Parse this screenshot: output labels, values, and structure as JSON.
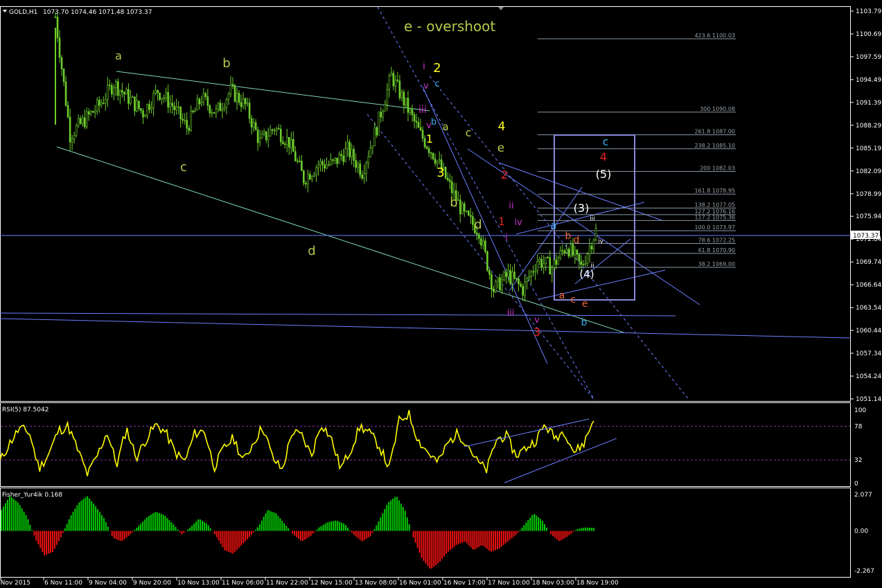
{
  "header": {
    "symbol": "GOLD,H1",
    "ohlc": "1073.70 1074.46 1071.48 1073.37",
    "current_price": "1073.37"
  },
  "colors": {
    "bull": "#6ecf2c",
    "bear": "#6ecf2c",
    "ma_line": "#7fd7b0",
    "channel": "#6a7fff",
    "rsi": "#ffff00",
    "fisher_up": "#00cc00",
    "fisher_down": "#ee1111",
    "box": "#8a8ad8"
  },
  "chart_data": [
    {
      "type": "candlestick",
      "title": "GOLD,H1",
      "subtitle_annotation": "e - overshoot",
      "y_ticks": [
        "1103.79",
        "1100.69",
        "1097.59",
        "1094.49",
        "1091.39",
        "1088.29",
        "1085.19",
        "1082.09",
        "1078.99",
        "1075.94",
        "1072.84",
        "1069.74",
        "1066.64",
        "1063.54",
        "1060.44",
        "1057.34",
        "1054.24",
        "1051.14"
      ],
      "x_ticks": [
        "5 Nov 2015",
        "6 Nov 11:00",
        "9 Nov 04:00",
        "9 Nov 20:00",
        "10 Nov 13:00",
        "11 Nov 06:00",
        "11 Nov 22:00",
        "12 Nov 15:00",
        "13 Nov 08:00",
        "16 Nov 01:00",
        "16 Nov 17:00",
        "17 Nov 10:00",
        "18 Nov 03:00",
        "18 Nov 19:00"
      ],
      "ylim": [
        1051.14,
        1103.79
      ],
      "approx_close_path": [
        1103,
        1087,
        1089,
        1091,
        1094,
        1092,
        1090,
        1093,
        1091,
        1088,
        1092,
        1090,
        1093,
        1091,
        1086,
        1088,
        1086,
        1081,
        1083,
        1083,
        1085,
        1082,
        1088,
        1095,
        1091,
        1087,
        1084,
        1080,
        1076,
        1074,
        1066,
        1068,
        1066,
        1070,
        1069,
        1072,
        1069,
        1074
      ],
      "fibonacci_levels": [
        {
          "label": "423.6 1100.03",
          "value": 1100.03
        },
        {
          "label": "300 1090.08",
          "value": 1090.08
        },
        {
          "label": "261.8 1087.00",
          "value": 1087.0
        },
        {
          "label": "238.2 1085.10",
          "value": 1085.1
        },
        {
          "label": "200 1082.03",
          "value": 1082.03
        },
        {
          "label": "161.8 1078.95",
          "value": 1078.95
        },
        {
          "label": "138.2 1077.05",
          "value": 1077.05
        },
        {
          "label": "127.2 1076.16",
          "value": 1076.16
        },
        {
          "label": "117.2 1075.36",
          "value": 1075.36
        },
        {
          "label": "100.0 1073.97",
          "value": 1073.97
        },
        {
          "label": "78.6 1072.25",
          "value": 1072.25
        },
        {
          "label": "61.8 1070.90",
          "value": 1070.9
        },
        {
          "label": "38.2 1069.00",
          "value": 1069.0
        }
      ],
      "wave_labels": [
        "a",
        "b",
        "c",
        "d",
        "e - overshoot",
        "2",
        "i",
        "v",
        "iii",
        "b",
        "c",
        "v",
        "1",
        "a",
        "3",
        "c",
        "4",
        "e",
        "b",
        "d",
        "2",
        "ii",
        "1",
        "iv",
        "i",
        "iii",
        "v",
        "3",
        "c",
        "4",
        "(5)",
        "(3)",
        "iii",
        "a",
        "b",
        "d",
        "iv",
        "(4)",
        "ii",
        "a",
        "c",
        "e",
        "b"
      ]
    },
    {
      "type": "line",
      "title": "RSI(5) 87.5042",
      "y_ticks": [
        "100",
        "78",
        "32",
        "0"
      ],
      "levels": [
        78,
        32
      ],
      "ylim": [
        0,
        100
      ],
      "values": [
        30,
        55,
        75,
        70,
        20,
        40,
        72,
        78,
        45,
        12,
        38,
        70,
        25,
        75,
        35,
        60,
        80,
        70,
        42,
        30,
        68,
        72,
        22,
        48,
        62,
        30,
        55,
        78,
        35,
        18,
        70,
        65,
        38,
        82,
        62,
        20,
        45,
        78,
        68,
        50,
        20,
        85,
        95,
        58,
        42,
        28,
        55,
        68,
        55,
        30,
        18,
        60,
        65,
        38,
        48,
        58,
        80,
        62,
        72,
        42,
        55,
        88
      ]
    },
    {
      "type": "bar",
      "title": "Fisher_Yur4ik 0.168",
      "y_ticks": [
        "2.077",
        "0.00",
        "-2.267"
      ],
      "ylim": [
        -2.267,
        2.077
      ],
      "values": [
        1.2,
        2.0,
        1.6,
        0.8,
        -0.5,
        -1.4,
        -1.2,
        -0.3,
        0.8,
        1.6,
        2.0,
        1.4,
        0.7,
        -0.4,
        -0.6,
        -0.2,
        0.3,
        0.8,
        1.1,
        0.9,
        0.4,
        -0.2,
        0.2,
        0.7,
        0.4,
        -0.3,
        -1.1,
        -1.3,
        -0.8,
        -0.3,
        0.3,
        1.2,
        1.0,
        0.4,
        -0.2,
        -0.6,
        -0.3,
        0.2,
        0.5,
        0.6,
        0.4,
        -0.2,
        -0.6,
        -0.3,
        0.6,
        1.6,
        2.0,
        1.2,
        -0.4,
        -1.6,
        -2.2,
        -1.8,
        -1.2,
        -0.8,
        -0.6,
        -1.1,
        -0.8,
        -1.2,
        -1.0,
        -0.6,
        -0.2,
        0.4,
        1.0,
        0.6,
        -0.2,
        -0.6,
        -0.3,
        0.1,
        0.2,
        0.17
      ]
    }
  ]
}
